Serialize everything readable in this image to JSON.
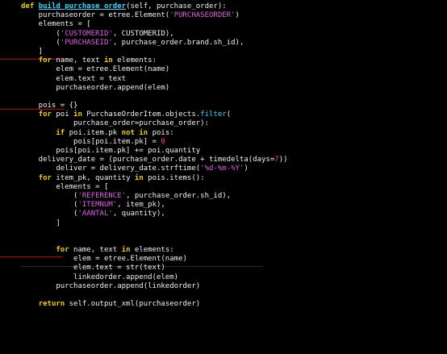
{
  "editor": {
    "lines": [
      [
        {
          "t": "def ",
          "c": "kw"
        },
        {
          "t": "build_purchase_order",
          "c": "fn"
        },
        {
          "t": "(self, purchase_order):",
          "c": "var"
        }
      ],
      [
        {
          "t": "    purchaseorder = etree.Element(",
          "c": "var"
        },
        {
          "t": "'PURCHASEORDER'",
          "c": "str"
        },
        {
          "t": ")",
          "c": "var"
        }
      ],
      [
        {
          "t": "    elements = [",
          "c": "var"
        }
      ],
      [
        {
          "t": "        (",
          "c": "var"
        },
        {
          "t": "'CUSTOMERID'",
          "c": "str"
        },
        {
          "t": ", CUSTOMERID),",
          "c": "var"
        }
      ],
      [
        {
          "t": "        (",
          "c": "var"
        },
        {
          "t": "'PURCHASEID'",
          "c": "str"
        },
        {
          "t": ", purchase_order.brand.sh_id),",
          "c": "var"
        }
      ],
      [
        {
          "t": "    ]",
          "c": "var"
        }
      ],
      [
        {
          "t": "    ",
          "c": "var"
        },
        {
          "t": "for",
          "c": "kw"
        },
        {
          "t": " name, text ",
          "c": "var"
        },
        {
          "t": "in",
          "c": "kw"
        },
        {
          "t": " elements:",
          "c": "var"
        }
      ],
      [
        {
          "t": "        elem = etree.Element(name)",
          "c": "var"
        }
      ],
      [
        {
          "t": "        elem.text = text",
          "c": "var"
        }
      ],
      [
        {
          "t": "        purchaseorder.append(elem)",
          "c": "var"
        }
      ],
      [
        {
          "t": "",
          "c": "var"
        }
      ],
      [
        {
          "t": "    pois = {}",
          "c": "var"
        }
      ],
      [
        {
          "t": "    ",
          "c": "var"
        },
        {
          "t": "for",
          "c": "kw"
        },
        {
          "t": " poi ",
          "c": "var"
        },
        {
          "t": "in",
          "c": "kw"
        },
        {
          "t": " PurchaseOrderItem.objects.",
          "c": "var"
        },
        {
          "t": "filter",
          "c": "cls"
        },
        {
          "t": "(",
          "c": "var"
        }
      ],
      [
        {
          "t": "            purchase_order=purchase_order):",
          "c": "var"
        }
      ],
      [
        {
          "t": "        ",
          "c": "var"
        },
        {
          "t": "if",
          "c": "kw"
        },
        {
          "t": " poi.item.pk ",
          "c": "var"
        },
        {
          "t": "not in",
          "c": "kw"
        },
        {
          "t": " pois:",
          "c": "var"
        }
      ],
      [
        {
          "t": "            pois[poi.item.pk] = ",
          "c": "var"
        },
        {
          "t": "0",
          "c": "num"
        }
      ],
      [
        {
          "t": "        pois[poi.item.pk] += poi.quantity",
          "c": "var"
        }
      ],
      [
        {
          "t": "    delivery_date = (purchase_order.date + timedelta(days=",
          "c": "var"
        },
        {
          "t": "7",
          "c": "num"
        },
        {
          "t": "))",
          "c": "var"
        }
      ],
      [
        {
          "t": "        deliver = delivery_date.strftime(",
          "c": "var"
        },
        {
          "t": "'%d-%m-%Y'",
          "c": "str"
        },
        {
          "t": ")",
          "c": "var"
        }
      ],
      [
        {
          "t": "    ",
          "c": "var"
        },
        {
          "t": "for",
          "c": "kw"
        },
        {
          "t": " item_pk, quantity ",
          "c": "var"
        },
        {
          "t": "in",
          "c": "kw"
        },
        {
          "t": " pois.items():",
          "c": "var"
        }
      ],
      [
        {
          "t": "        elements = [",
          "c": "var"
        }
      ],
      [
        {
          "t": "            (",
          "c": "var"
        },
        {
          "t": "'REFERENCE'",
          "c": "str"
        },
        {
          "t": ", purchase_order.sh_id),",
          "c": "var"
        }
      ],
      [
        {
          "t": "            (",
          "c": "var"
        },
        {
          "t": "'ITEMNUM'",
          "c": "str"
        },
        {
          "t": ", item_pk),",
          "c": "var"
        }
      ],
      [
        {
          "t": "            (",
          "c": "var"
        },
        {
          "t": "'AANTAL'",
          "c": "str"
        },
        {
          "t": ", quantity),",
          "c": "var"
        }
      ],
      [
        {
          "t": "        ]",
          "c": "var"
        }
      ],
      [
        {
          "t": "",
          "c": "var"
        }
      ],
      [
        {
          "t": "",
          "c": "var"
        }
      ],
      [
        {
          "t": "        ",
          "c": "var"
        },
        {
          "t": "for",
          "c": "kw"
        },
        {
          "t": " name, text ",
          "c": "var"
        },
        {
          "t": "in",
          "c": "kw"
        },
        {
          "t": " elements:",
          "c": "var"
        }
      ],
      [
        {
          "t": "            elem = etree.Element(name)",
          "c": "var"
        }
      ],
      [
        {
          "t": "            elem.text = str(text)",
          "c": "var"
        }
      ],
      [
        {
          "t": "            linkedorder.append(elem)",
          "c": "var"
        }
      ],
      [
        {
          "t": "        purchaseorder.append(linkedorder)",
          "c": "var"
        }
      ],
      [
        {
          "t": "",
          "c": "var"
        }
      ],
      [
        {
          "t": "    ",
          "c": "var"
        },
        {
          "t": "return",
          "c": "kw"
        },
        {
          "t": " self.output_xml(purchaseorder)",
          "c": "var"
        }
      ]
    ]
  },
  "colors": {
    "keyword": "#f0d000",
    "function": "#35d8ff",
    "string": "#e060e8",
    "number": "#ff4d4d",
    "text": "#f0f0f0",
    "marker": "#c00000",
    "background": "#000000"
  }
}
